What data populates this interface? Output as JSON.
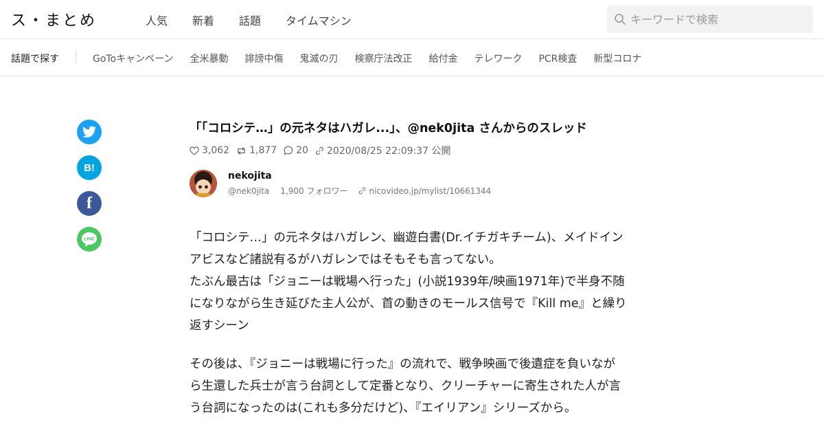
{
  "header": {
    "logo": "ス・まとめ",
    "nav": [
      "人気",
      "新着",
      "話題",
      "タイムマシン"
    ],
    "search_placeholder": "キーワードで検索"
  },
  "topics": {
    "lead": "話題で探す",
    "items": [
      "GoToキャンペーン",
      "全米暴動",
      "誹謗中傷",
      "鬼滅の刃",
      "検察庁法改正",
      "給付金",
      "テレワーク",
      "PCR検査",
      "新型コロナ"
    ]
  },
  "share": {
    "twitter_icon": "twitter-icon",
    "hatena_label": "B!",
    "facebook_label": "f",
    "line_label": "LINE"
  },
  "article": {
    "title": "「「コロシテ…」の元ネタはハガレ...」、@nek0jita さんからのスレッド",
    "likes": "3,062",
    "retweets": "1,877",
    "comments": "20",
    "published": "2020/08/25 22:09:37 公開"
  },
  "author": {
    "name": "nekojita",
    "handle": "@nek0jita",
    "followers": "1,900 フォロワー",
    "link": "nicovideo.jp/mylist/10661344"
  },
  "tweets": [
    {
      "lines": [
        "「コロシテ…」の元ネタはハガレン、幽遊白書(Dr.イチガキチーム)、メイドイン",
        "アビスなど諸説有るがハガレンではそもそも言ってない。",
        "たぶん最古は「ジョニーは戦場へ行った」(小説1939年/映画1971年)で半身不随",
        "になりながら生き延びた主人公が、首の動きのモールス信号で『Kill me』と繰り",
        "返すシーン"
      ]
    },
    {
      "lines": [
        "その後は、『ジョニーは戦場に行った』の流れで、戦争映画で後遺症を負いなが",
        "ら生還した兵士が言う台詞として定番となり、クリーチャーに寄生された人が言",
        "う台詞になったのは(これも多分だけど)、『エイリアン』シリーズから。"
      ]
    }
  ]
}
